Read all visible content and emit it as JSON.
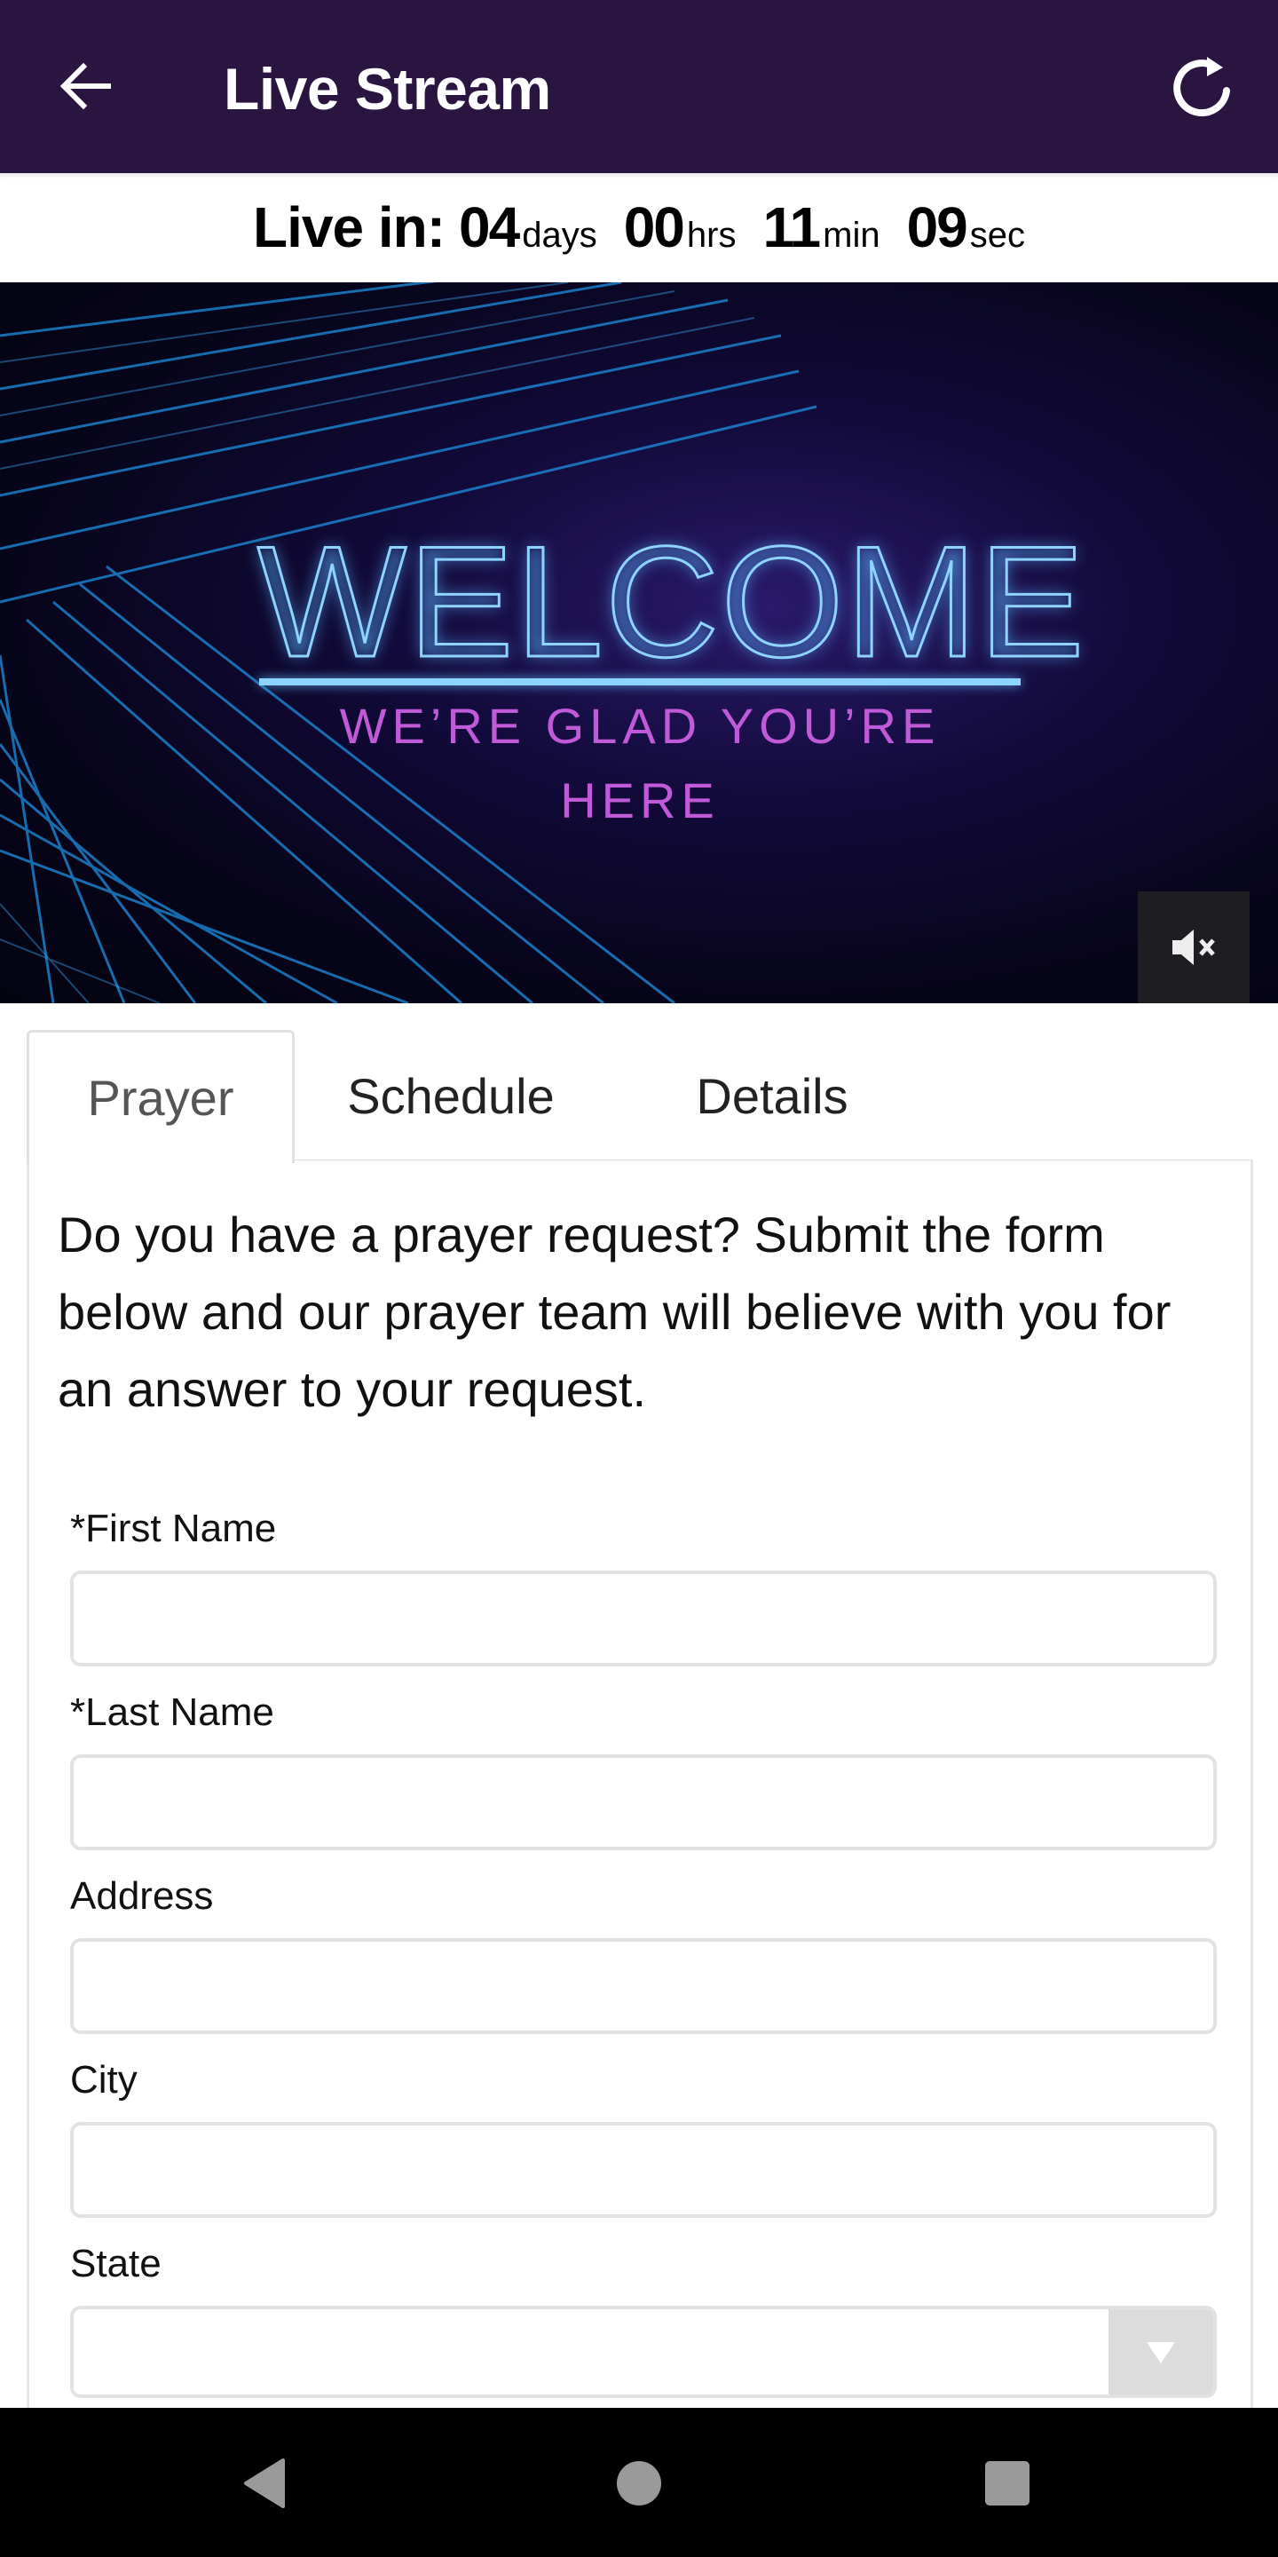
{
  "appbar": {
    "title": "Live Stream",
    "back_icon": "arrow-left-icon",
    "refresh_icon": "refresh-icon",
    "background_color": "#2a1440"
  },
  "countdown": {
    "label": "Live in:",
    "days": "04",
    "days_unit": "days",
    "hours": "00",
    "hours_unit": "hrs",
    "minutes": "11",
    "minutes_unit": "min",
    "seconds": "09",
    "seconds_unit": "sec"
  },
  "video": {
    "headline": "WELCOME",
    "subheadline": "WE’RE GLAD YOU’RE HERE",
    "mute_icon": "volume-muted-icon"
  },
  "tabs": [
    {
      "label": "Prayer",
      "active": true
    },
    {
      "label": "Schedule",
      "active": false
    },
    {
      "label": "Details",
      "active": false
    }
  ],
  "prayer": {
    "intro": "Do you have a prayer request? Submit the form below and our prayer team will believe with you for an answer to your request.",
    "fields": [
      {
        "label": "*First Name",
        "value": "",
        "placeholder": ""
      },
      {
        "label": "*Last Name",
        "value": "",
        "placeholder": ""
      },
      {
        "label": "Address",
        "value": "",
        "placeholder": ""
      },
      {
        "label": "City",
        "value": "",
        "placeholder": ""
      }
    ],
    "state": {
      "label": "State",
      "selected": ""
    }
  },
  "system_nav": {
    "back": "nav-back-icon",
    "home": "nav-home-icon",
    "recents": "nav-recents-icon"
  }
}
